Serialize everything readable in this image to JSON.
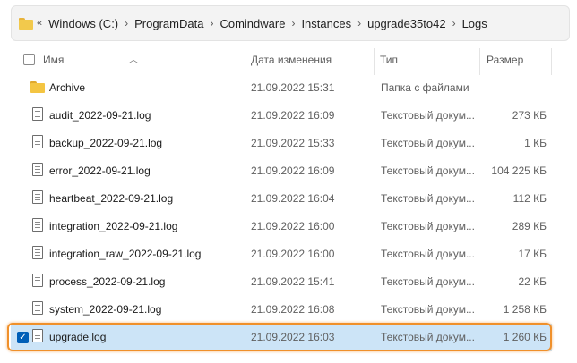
{
  "addressbar": {
    "overflow": "«",
    "crumbs": [
      "Windows (C:)",
      "ProgramData",
      "Comindware",
      "Instances",
      "upgrade35to42",
      "Logs"
    ]
  },
  "header": {
    "name": "Имя",
    "date": "Дата изменения",
    "type": "Тип",
    "size": "Размер"
  },
  "files": [
    {
      "name": "Archive",
      "date": "21.09.2022 15:31",
      "type": "Папка с файлами",
      "size": "",
      "kind": "folder"
    },
    {
      "name": "audit_2022-09-21.log",
      "date": "21.09.2022 16:09",
      "type": "Текстовый докум...",
      "size": "273 КБ",
      "kind": "file"
    },
    {
      "name": "backup_2022-09-21.log",
      "date": "21.09.2022 15:33",
      "type": "Текстовый докум...",
      "size": "1 КБ",
      "kind": "file"
    },
    {
      "name": "error_2022-09-21.log",
      "date": "21.09.2022 16:09",
      "type": "Текстовый докум...",
      "size": "104 225 КБ",
      "kind": "file"
    },
    {
      "name": "heartbeat_2022-09-21.log",
      "date": "21.09.2022 16:04",
      "type": "Текстовый докум...",
      "size": "112 КБ",
      "kind": "file"
    },
    {
      "name": "integration_2022-09-21.log",
      "date": "21.09.2022 16:00",
      "type": "Текстовый докум...",
      "size": "289 КБ",
      "kind": "file"
    },
    {
      "name": "integration_raw_2022-09-21.log",
      "date": "21.09.2022 16:00",
      "type": "Текстовый докум...",
      "size": "17 КБ",
      "kind": "file"
    },
    {
      "name": "process_2022-09-21.log",
      "date": "21.09.2022 15:41",
      "type": "Текстовый докум...",
      "size": "22 КБ",
      "kind": "file"
    },
    {
      "name": "system_2022-09-21.log",
      "date": "21.09.2022 16:08",
      "type": "Текстовый докум...",
      "size": "1 258 КБ",
      "kind": "file"
    },
    {
      "name": "upgrade.log",
      "date": "21.09.2022 16:03",
      "type": "Текстовый докум...",
      "size": "1 260 КБ",
      "kind": "file",
      "selected": true
    }
  ],
  "colors": {
    "selection": "#cce4f7",
    "highlight": "#f0902a",
    "checkbox": "#005fb8"
  }
}
